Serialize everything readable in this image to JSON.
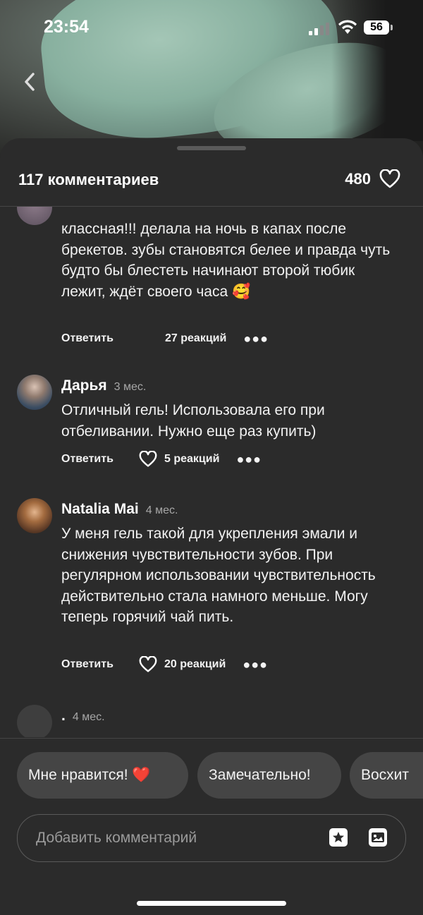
{
  "status_bar": {
    "time": "23:54",
    "battery": "56"
  },
  "header": {
    "comments_count": "117 комментариев",
    "likes_count": "480"
  },
  "comments": [
    {
      "author": "",
      "age": "",
      "text": "классная!!! делала на ночь в капах после брекетов. зубы становятся белее и правда чуть будто бы блестеть начинают второй тюбик лежит, ждёт своего часа 🥰",
      "reply_label": "Ответить",
      "reactions": "27 реакций"
    },
    {
      "author": "Дарья",
      "age": "3 мес.",
      "text": "Отличный гель! Использовала его при отбеливании. Нужно еще раз купить)",
      "reply_label": "Ответить",
      "reactions": "5 реакций"
    },
    {
      "author": "Natalia Mai",
      "age": "4 мес.",
      "text": "У меня гель такой для укрепления эмали и снижения чувствительности зубов. При регулярном использовании чувствительность действительно стала намного меньше. Могу теперь горячий чай пить.",
      "reply_label": "Ответить",
      "reactions": "20 реакций"
    },
    {
      "author": ".",
      "age": "4 мес."
    }
  ],
  "quick_reactions": [
    "Мне нравится! ❤️",
    "Замечательно!",
    "Восхит"
  ],
  "composer": {
    "placeholder": "Добавить комментарий"
  },
  "icons": {
    "back": "chevron-left-icon",
    "like": "heart-outline-icon",
    "sticker": "sticker-icon",
    "image": "image-icon",
    "more": "more-dots-icon"
  }
}
